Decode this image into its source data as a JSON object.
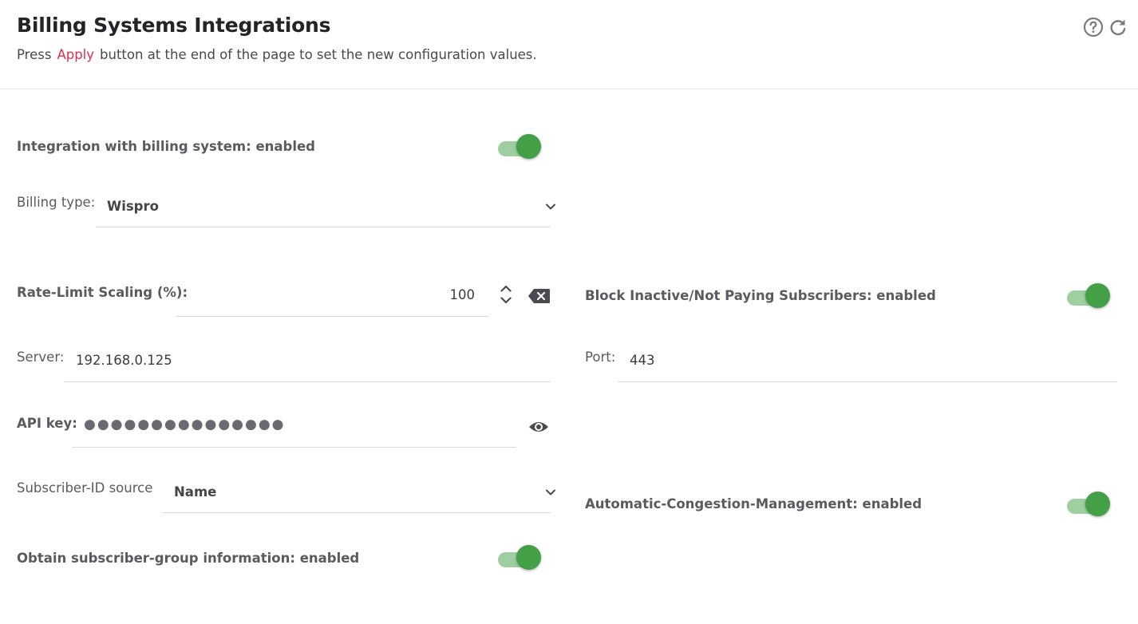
{
  "header": {
    "title": "Billing Systems Integrations",
    "subtitle_before": "Press",
    "subtitle_link": "Apply",
    "subtitle_after": "button at the end of the page to set the new configuration values.",
    "icons": [
      "help-circle-icon",
      "refresh-icon"
    ]
  },
  "integration": {
    "label": "Integration with billing system: enabled",
    "enabled": true
  },
  "billing_type": {
    "label": "Billing type:",
    "value": "Wispro"
  },
  "rate_limit": {
    "label": "Rate-Limit Scaling (%):",
    "value": "100"
  },
  "block_inactive": {
    "label": "Block Inactive/Not Paying Subscribers: enabled",
    "enabled": true
  },
  "server": {
    "label": "Server:",
    "value": "192.168.0.125"
  },
  "port": {
    "label": "Port:",
    "value": "443"
  },
  "api_key": {
    "label": "API key:",
    "masked": "●●●●●●●●●●●●●●●"
  },
  "subscriber_id_source": {
    "label": "Subscriber-ID source",
    "value": "Name"
  },
  "auto_congestion": {
    "label": "Automatic-Congestion-Management: enabled",
    "enabled": true
  },
  "obtain_group": {
    "label": "Obtain subscriber-group information: enabled",
    "enabled": true
  },
  "colors": {
    "accent_green": "#43a046",
    "track_green": "#9fcfa1",
    "link_red": "#d9304e"
  }
}
